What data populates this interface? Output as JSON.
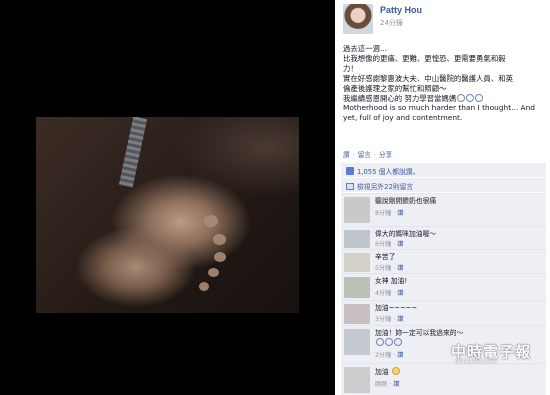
{
  "author": {
    "name": "Patty Hou",
    "time": "24分鐘"
  },
  "post": {
    "lines": [
      "過去這一週...",
      "比我想像的更痛、更難、更惶恐、更需要勇氣和毅",
      "力！",
      "實在好感謝黎惠波大夫、中山醫院的醫護人員、和英",
      "倫產後護理之家的幫忙和照顧～",
      "我繼續感恩開心的  努力學習當媽媽",
      "Motherhood is so much harder than I thought... And",
      "yet, full of joy and contentment."
    ]
  },
  "actions": {
    "like": "讚",
    "comment": "留言",
    "share": "分享"
  },
  "likes": {
    "text": "1,055 個人都說讚。"
  },
  "more_comments": {
    "text": "檢視另外22則留言"
  },
  "comments": [
    {
      "text": [
        "聽說剛開餵奶也很痛"
      ],
      "time": "8分鐘",
      "like": "讚",
      "avatar_color": "#c9c9c9"
    },
    {
      "text": [
        "偉大的媽咪加油喔～"
      ],
      "time": "6分鐘",
      "like": "讚",
      "avatar_color": "#bfc6cc"
    },
    {
      "text": [
        "辛苦了"
      ],
      "time": "5分鐘",
      "like": "讚",
      "avatar_color": "#d3cfc9"
    },
    {
      "text": [
        "女神 加油!"
      ],
      "time": "4分鐘",
      "like": "讚",
      "avatar_color": "#b9c2b5"
    },
    {
      "text": [
        "加油~~~~~"
      ],
      "time": "3分鐘",
      "like": "讚",
      "avatar_color": "#c7bfc3"
    },
    {
      "text": [
        "加油！妳一定可以我過來的～"
      ],
      "time": "2分鐘",
      "like": "讚",
      "avatar_color": "#c4c9d1"
    },
    {
      "text": [
        "加油"
      ],
      "time": "剛剛",
      "like": "讚",
      "avatar_color": "#cccccc"
    }
  ],
  "watermark": {
    "logo": "中時電子報",
    "url": "chinatimes.com"
  }
}
